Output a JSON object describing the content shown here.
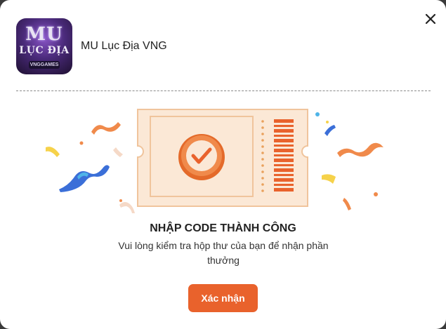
{
  "app": {
    "name": "MU Lục Địa VNG",
    "icon_title_top": "MU",
    "icon_title_mid": "LỤC ĐỊA",
    "icon_badge": "VNGGAMES"
  },
  "dialog": {
    "close_icon": "close-icon",
    "illustration_icon": "ticket-checkmark-icon",
    "title": "NHẬP CODE THÀNH CÔNG",
    "message": "Vui lòng kiểm tra hộp thư của bạn để nhận phần thưởng",
    "confirm_label": "Xác nhận"
  },
  "colors": {
    "accent": "#e9622c",
    "ticket_fill": "#fbe8d6",
    "ticket_border": "#f0c49c",
    "confetti_orange": "#f08a4b",
    "confetti_blue": "#3b6fd8",
    "confetti_yellow": "#f6d24a"
  }
}
